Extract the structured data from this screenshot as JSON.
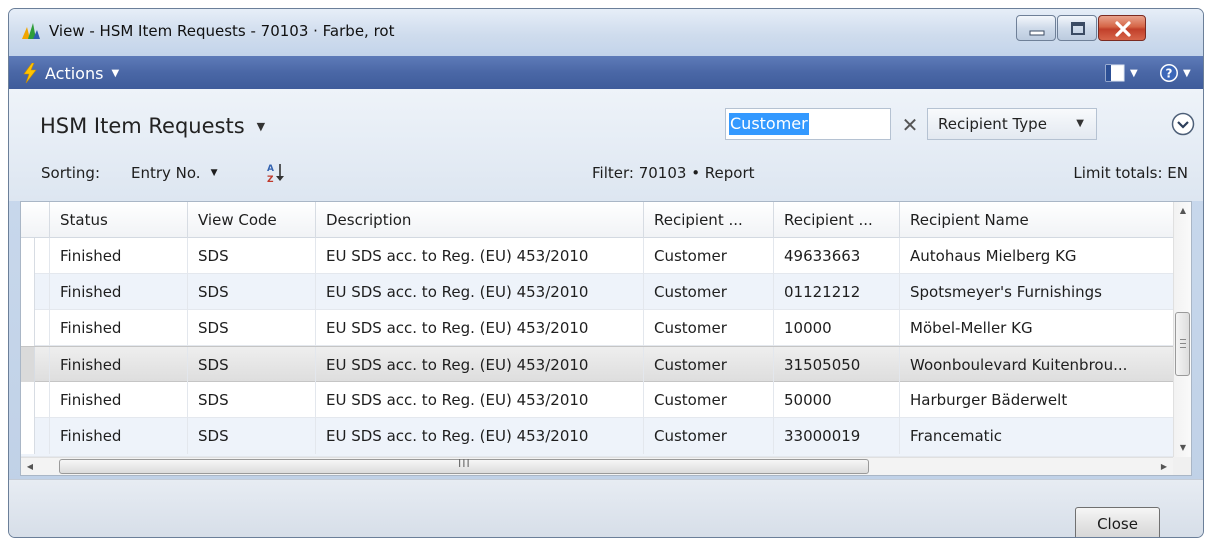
{
  "window": {
    "title": "View - HSM Item Requests - 70103 · Farbe, rot"
  },
  "actions": {
    "label": "Actions"
  },
  "header": {
    "page_title": "HSM Item Requests",
    "search_value": "Customer",
    "filter_field": "Recipient Type",
    "sorting_label": "Sorting:",
    "sorting_field": "Entry No.",
    "filter_text": "Filter: 70103 • Report",
    "limit_text": "Limit totals: EN"
  },
  "grid": {
    "columns": [
      "Status",
      "View Code",
      "Description",
      "Recipient ...",
      "Recipient ...",
      "Recipient Name"
    ],
    "rows": [
      {
        "status": "Finished",
        "view_code": "SDS",
        "description": "EU SDS acc. to  Reg. (EU) 453/2010",
        "recipient_type": "Customer",
        "recipient_no": "49633663",
        "recipient_name": "Autohaus Mielberg KG"
      },
      {
        "status": "Finished",
        "view_code": "SDS",
        "description": "EU SDS acc. to  Reg. (EU) 453/2010",
        "recipient_type": "Customer",
        "recipient_no": "01121212",
        "recipient_name": "Spotsmeyer's Furnishings"
      },
      {
        "status": "Finished",
        "view_code": "SDS",
        "description": "EU SDS acc. to  Reg. (EU) 453/2010",
        "recipient_type": "Customer",
        "recipient_no": "10000",
        "recipient_name": "Möbel-Meller KG"
      },
      {
        "status": "Finished",
        "view_code": "SDS",
        "description": "EU SDS acc. to  Reg. (EU) 453/2010",
        "recipient_type": "Customer",
        "recipient_no": "31505050",
        "recipient_name": "Woonboulevard Kuitenbrou..."
      },
      {
        "status": "Finished",
        "view_code": "SDS",
        "description": "EU SDS acc. to  Reg. (EU) 453/2010",
        "recipient_type": "Customer",
        "recipient_no": "50000",
        "recipient_name": "Harburger Bäderwelt"
      },
      {
        "status": "Finished",
        "view_code": "SDS",
        "description": "EU SDS acc. to  Reg. (EU) 453/2010",
        "recipient_type": "Customer",
        "recipient_no": "33000019",
        "recipient_name": "Francematic"
      }
    ],
    "selected_row": 3,
    "scrollbar_grip": "III"
  },
  "footer": {
    "close_label": "Close"
  },
  "colors": {
    "actions_bar": "#4a67a6",
    "selection": "#3399ff",
    "close_button": "#c1402a"
  },
  "icons": [
    "app-icon",
    "minimize-icon",
    "maximize-icon",
    "close-icon",
    "lightning-icon",
    "layout-icon",
    "help-icon",
    "clear-icon",
    "expand-icon",
    "sort-direction-icon"
  ]
}
